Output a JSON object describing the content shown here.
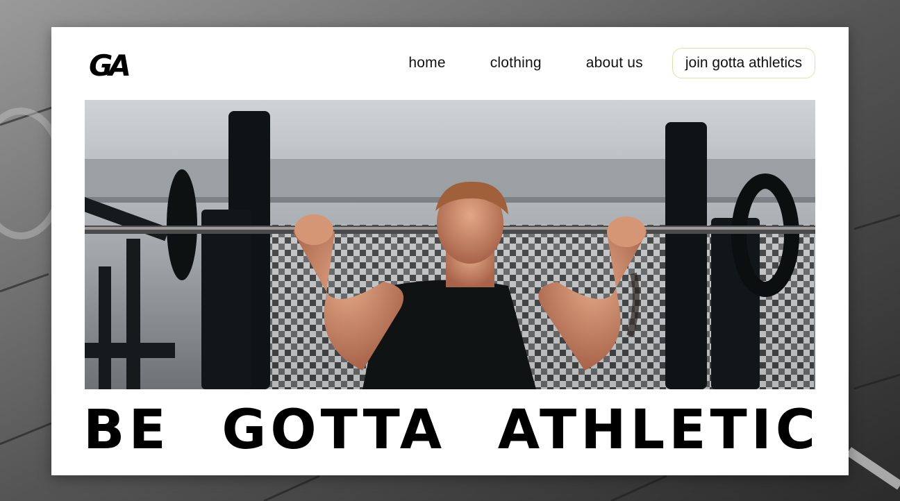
{
  "brand": {
    "logo_text": "GA"
  },
  "nav": {
    "items": [
      {
        "label": "home"
      },
      {
        "label": "clothing"
      },
      {
        "label": "about us"
      }
    ],
    "cta_label": "join gotta athletics"
  },
  "hero": {
    "image": "weightlifter-barbell-photo",
    "headline": "BE GOTTA ATHLETIC"
  },
  "colors": {
    "card_background": "#ffffff",
    "text": "#111111",
    "cta_border": "#dfe2a5",
    "backdrop": "#4a4a4a"
  }
}
